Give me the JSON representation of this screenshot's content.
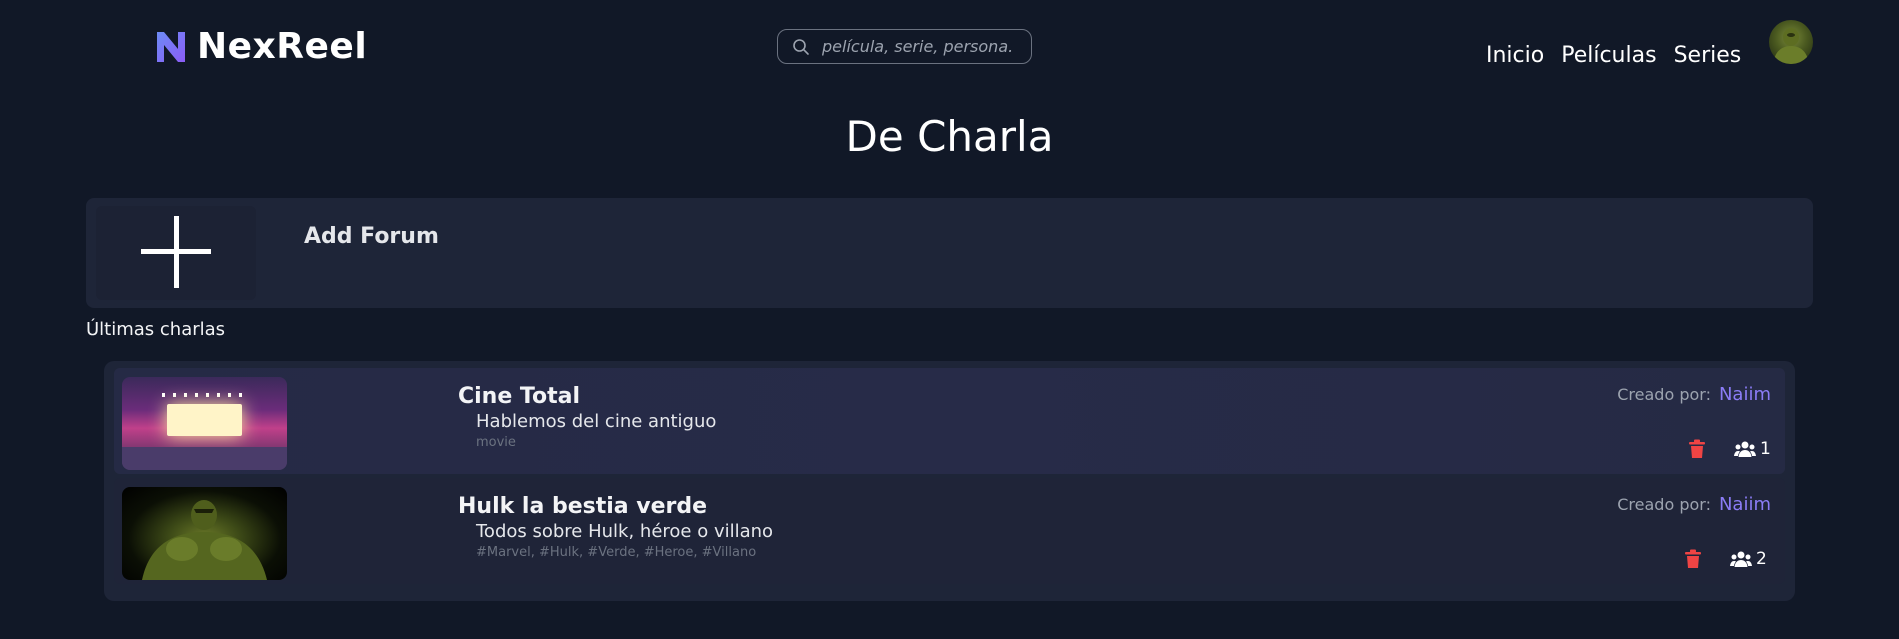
{
  "header": {
    "brand": "NexReel",
    "search": {
      "placeholder": "película, serie, persona..."
    },
    "nav": [
      {
        "label": "Inicio"
      },
      {
        "label": "Películas"
      },
      {
        "label": "Series"
      }
    ]
  },
  "page": {
    "title": "De Charla",
    "add_forum_label": "Add Forum",
    "section_label": "Últimas charlas"
  },
  "forums": [
    {
      "title": "Cine Total",
      "description": "Hablemos del cine antiguo",
      "tags": "movie",
      "created_by_label": "Creado por:",
      "creator": "Naiim",
      "members": "1"
    },
    {
      "title": "Hulk la bestia verde",
      "description": "Todos sobre Hulk, héroe o villano",
      "tags": "#Marvel, #Hulk, #Verde, #Heroe, #Villano",
      "created_by_label": "Creado por:",
      "creator": "Naiim",
      "members": "2"
    }
  ],
  "colors": {
    "background": "#111827",
    "panel": "#1e2538",
    "accent": "#8b7cf6",
    "delete": "#ef4444"
  }
}
